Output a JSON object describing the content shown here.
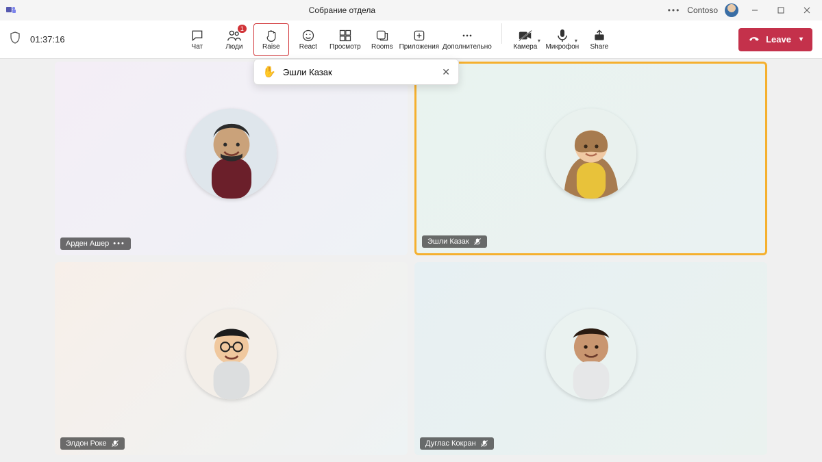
{
  "titlebar": {
    "app_name": "Teams",
    "meeting_title": "Собрание отдела",
    "org": "Contoso"
  },
  "toolbar": {
    "timer": "01:37:16",
    "buttons": {
      "chat": "Чат",
      "people": "Люди",
      "people_badge": "1",
      "raise": "Raise",
      "react": "React",
      "view": "Просмотр",
      "rooms": "Rooms",
      "apps": "Приложения",
      "more": "Дополнительно",
      "camera": "Камера",
      "mic": "Микрофон",
      "share": "Share"
    },
    "leave_label": "Leave"
  },
  "toast": {
    "hand_emoji": "✋",
    "name": "Эшли Казак"
  },
  "participants": [
    {
      "name": "Арден Ашер",
      "muted": false,
      "more": true,
      "raised": false
    },
    {
      "name": "Эшли Казак",
      "muted": true,
      "more": false,
      "raised": true
    },
    {
      "name": "Элдон Роке",
      "muted": true,
      "more": false,
      "raised": false
    },
    {
      "name": "Дуглас Кокран",
      "muted": true,
      "more": false,
      "raised": false
    }
  ],
  "colors": {
    "accent_red": "#c4314b",
    "raise_border": "#d13438",
    "hand_highlight": "#f5b02e"
  }
}
